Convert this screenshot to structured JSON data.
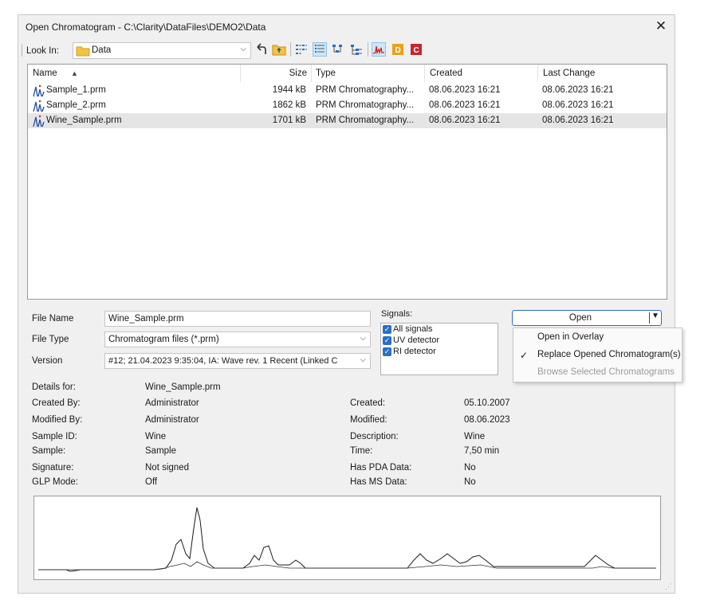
{
  "window": {
    "title": "Open Chromatogram - C:\\Clarity\\DataFiles\\DEMO2\\Data",
    "close_icon": "close-icon"
  },
  "toolbar": {
    "look_in_label": "Look In:",
    "look_in_value": "Data",
    "icons": [
      "back-icon",
      "up-folder-icon",
      "list-view-icon",
      "details-view-icon",
      "tree-view-icon",
      "tree-detail-icon",
      "chromatogram-icon",
      "folder-d-icon",
      "folder-c-icon"
    ]
  },
  "file_list": {
    "columns": {
      "name": "Name",
      "size": "Size",
      "type": "Type",
      "created": "Created",
      "last_change": "Last Change"
    },
    "rows": [
      {
        "name": "Sample_1.prm",
        "size": "1944 kB",
        "type": "PRM Chromatography...",
        "created": "08.06.2023 16:21",
        "last_change": "08.06.2023 16:21"
      },
      {
        "name": "Sample_2.prm",
        "size": "1862 kB",
        "type": "PRM Chromatography...",
        "created": "08.06.2023 16:21",
        "last_change": "08.06.2023 16:21"
      },
      {
        "name": "Wine_Sample.prm",
        "size": "1701 kB",
        "type": "PRM Chromatography...",
        "created": "08.06.2023 16:21",
        "last_change": "08.06.2023 16:21"
      }
    ]
  },
  "form": {
    "file_name_label": "File Name",
    "file_name_value": "Wine_Sample.prm",
    "file_type_label": "File Type",
    "file_type_value": "Chromatogram files (*.prm)",
    "version_label": "Version",
    "version_value": "#12;   21.04.2023   9:35:04,   IA: Wave rev. 1 Recent (Linked C"
  },
  "signals": {
    "label": "Signals:",
    "items": [
      "All signals",
      "UV detector",
      "RI detector"
    ]
  },
  "open_button": {
    "label": "Open"
  },
  "open_menu": {
    "items": [
      {
        "label": "Open in Overlay",
        "checked": false,
        "enabled": true
      },
      {
        "label": "Replace Opened Chromatogram(s)",
        "checked": true,
        "enabled": true
      },
      {
        "label": "Browse Selected Chromatograms",
        "checked": false,
        "enabled": false
      }
    ]
  },
  "details": {
    "details_for_label": "Details for:",
    "details_for_value": "Wine_Sample.prm",
    "created_by_label": "Created By:",
    "created_by_value": "Administrator",
    "modified_by_label": "Modified By:",
    "modified_by_value": "Administrator",
    "sample_id_label": "Sample ID:",
    "sample_id_value": "Wine",
    "sample_label": "Sample:",
    "sample_value": "Sample",
    "signature_label": "Signature:",
    "signature_value": "Not signed",
    "glp_label": "GLP Mode:",
    "glp_value": "Off",
    "created_label": "Created:",
    "created_value": "05.10.2007",
    "modified_label": "Modified:",
    "modified_value": "08.06.2023",
    "description_label": "Description:",
    "description_value": "Wine",
    "time_label": "Time:",
    "time_value": "7,50 min",
    "pda_label": "Has PDA Data:",
    "pda_value": "No",
    "ms_label": "Has MS Data:",
    "ms_value": "No"
  },
  "colors": {
    "accent": "#2a6fc9",
    "selected_row": "#e5e5e5",
    "folder": "#f5c342"
  }
}
